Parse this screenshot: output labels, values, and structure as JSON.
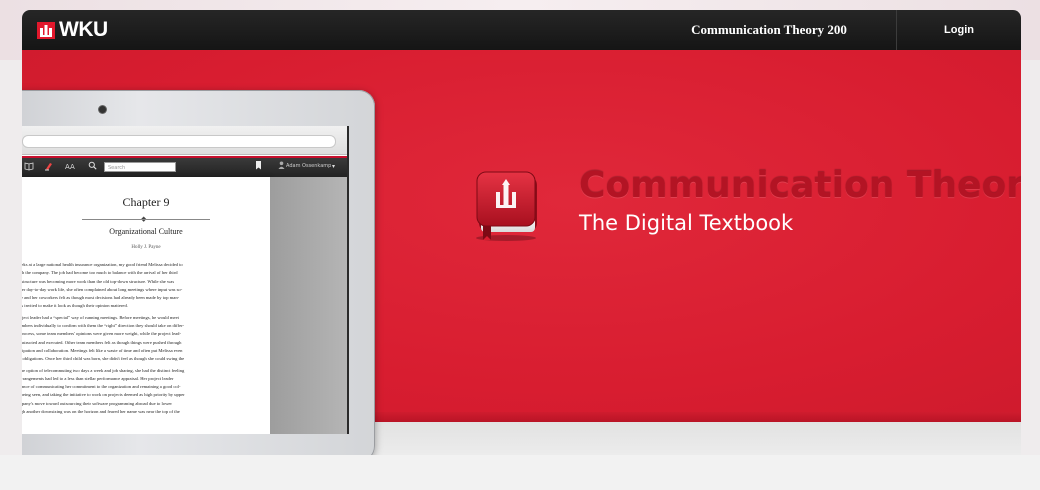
{
  "header": {
    "logo_text": "WKU",
    "course_link": "Communication Theory 200",
    "login_label": "Login"
  },
  "hero": {
    "title": "Communication Theory",
    "subtitle": "The Digital Textbook"
  },
  "reader": {
    "search_placeholder": "Search",
    "user_name": "Adam Ossenkamp",
    "font_button": "AA"
  },
  "document": {
    "chapter": "Chapter 9",
    "title": "Organizational Culture",
    "author": "Holly J. Payne",
    "paragraphs": [
      [
        "weeks at a large national health insurance organization, my good friend Melissa decided to",
        "with the company. The job had become too much to balance with the arrival of her third",
        "ed structure was becoming more work than the old top-down structure. While she was",
        "n her day-to-day work life, she often complained about long meetings where input was so-",
        "She and her coworkers felt as though most decisions had already been made by top man-",
        "was invited to make it look as though their opinion mattered."
      ],
      [
        "project leader had a “special” way of running meetings. Before meetings, he would meet",
        "members individually to confirm with them the “right” direction they should take on differ-",
        "is process, some team members' opinions were given more weight, while the project lead-",
        "constructed and executed. Other team members felt as though things were pushed through",
        "rticipation and collaboration. Meetings felt like a waste of time and often put Melissa even",
        "ect obligations. Once her third child was born, she didn't feel as though she could swing the"
      ],
      [
        "d the option of telecommuting two days a week and job sharing, she had the distinct feeling",
        "e arrangements had led to a less than stellar performance appraisal. Her project leader",
        "ortance of communicating her commitment to the organization and remaining a good col-",
        "d, being seen, and taking the initiative to work on projects deemed as high priority by upper",
        "ompany's move toward outsourcing their software programming abroad due to lower",
        "ough another downsizing was on the horizon and feared her name was near the top of the"
      ]
    ]
  },
  "colors": {
    "brand_red": "#d81d30",
    "topbar": "#1a1a1a"
  },
  "icons": {
    "logo": "wku-cupola-icon",
    "book": "book-icon",
    "toc": "book-open-icon",
    "highlight": "highlighter-icon",
    "search": "search-icon",
    "bookmark": "bookmark-icon",
    "user": "user-icon"
  }
}
